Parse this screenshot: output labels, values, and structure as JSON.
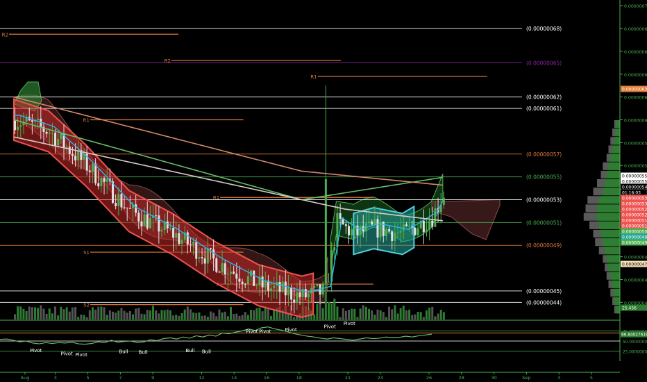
{
  "chart_data": {
    "type": "line",
    "theme": {
      "background": "#000000",
      "price_axis_color": "#4caf50",
      "up": "#4caf50",
      "down": "#ef5350",
      "pivot_color": "#e07b39",
      "fib_color": "#ffffff"
    },
    "price_axis": {
      "ylim": [
        4.25e-07,
        7.05e-08
      ],
      "ticks": [
        "0.00000070",
        "0.00000068",
        "0.00000066",
        "0.00000064",
        "0.00000062",
        "0.00000060",
        "0.00000058",
        "0.00000056",
        "0.00000054",
        "0.00000052",
        "0.00000050",
        "0.00000048",
        "0.00000046",
        "0.00000044"
      ]
    },
    "price_scale": {
      "min": 4.25e-07,
      "max": 7.05e-07
    },
    "time_axis": {
      "labels": [
        "Aug",
        "3",
        "5",
        "7",
        "9",
        "12",
        "14",
        "16",
        "18",
        "21",
        "23",
        "26",
        "28",
        "30",
        "Sep",
        "3",
        "5"
      ],
      "positions_days": [
        0,
        2,
        4,
        6,
        8,
        11,
        13,
        15,
        17,
        20,
        22,
        25,
        27,
        29,
        31,
        33,
        35
      ]
    },
    "level_lines": [
      {
        "label": "(0.00000068)",
        "price": 6.8e-07,
        "color": "#ffffff"
      },
      {
        "label": "(0.00000065)",
        "price": 6.5e-07,
        "color": "#8e24aa"
      },
      {
        "label": "(0.00000062)",
        "price": 6.2e-07,
        "color": "#ffffff"
      },
      {
        "label": "(0.00000061)",
        "price": 6.1e-07,
        "color": "#ffffff"
      },
      {
        "label": "(0.00000057)",
        "price": 5.7e-07,
        "color": "#e07b39"
      },
      {
        "label": "(0.00000055)",
        "price": 5.5e-07,
        "color": "#4caf50"
      },
      {
        "label": "(0.00000053)",
        "price": 5.3e-07,
        "color": "#ffffff"
      },
      {
        "label": "(0.00000051)",
        "price": 5.1e-07,
        "color": "#4caf50"
      },
      {
        "label": "(0.00000049)",
        "price": 4.9e-07,
        "color": "#e07b39"
      },
      {
        "label": "(0.00000045)",
        "price": 4.5e-07,
        "color": "#ffffff"
      },
      {
        "label": "(0.00000044)",
        "price": 4.4e-07,
        "color": "#ffffff"
      }
    ],
    "pivots": [
      {
        "label": "R2",
        "price": 6.75e-07,
        "x_start_day": 0,
        "x_end_day": 10
      },
      {
        "label": "R2",
        "price": 6.52e-07,
        "x_start_day": 10,
        "x_end_day": 20
      },
      {
        "label": "R1",
        "price": 6.38e-07,
        "x_start_day": 19,
        "x_end_day": 29
      },
      {
        "label": "R1",
        "price": 6e-07,
        "x_start_day": 5,
        "x_end_day": 14
      },
      {
        "label": "R1",
        "price": 5.32e-07,
        "x_start_day": 13,
        "x_end_day": 22
      },
      {
        "label": "S1",
        "price": 4.84e-07,
        "x_start_day": 5,
        "x_end_day": 14
      },
      {
        "label": "P",
        "price": 4.56e-07,
        "x_start_day": 13,
        "x_end_day": 22
      },
      {
        "label": "S2",
        "price": 4.38e-07,
        "x_start_day": 5,
        "x_end_day": 14
      }
    ],
    "price_badges": [
      {
        "label": "0.00000063",
        "bg": "#e07b39"
      },
      {
        "label": "0.00000055",
        "bg": "#ffffff"
      },
      {
        "label": "0.00000055",
        "bg": "#ffffff"
      },
      {
        "label": "0.00000054",
        "bg": "#000000"
      },
      {
        "label": "01:16:03",
        "bg": "#000000"
      },
      {
        "label": "0.00000053",
        "bg": "#ef5350"
      },
      {
        "label": "0.00000053",
        "bg": "#ef5350"
      },
      {
        "label": "0.00000052",
        "bg": "#ef5350"
      },
      {
        "label": "0.00000052",
        "bg": "#ef5350"
      },
      {
        "label": "0.00000051",
        "bg": "#ef5350"
      },
      {
        "label": "0.00000051",
        "bg": "#ef5350"
      },
      {
        "label": "0.00000050",
        "bg": "#4caf50"
      },
      {
        "label": "0.00000049",
        "bg": "#26a69a"
      },
      {
        "label": "0.00000049",
        "bg": "#4caf50"
      },
      {
        "label": "0.00000047",
        "bg": "#f5deb3"
      },
      {
        "label": "25.456",
        "bg": "#2e7d32"
      }
    ],
    "oscillator": {
      "ticks": [
        "75.00000000",
        "66.84027619",
        "50.00000000",
        "25.00000000"
      ],
      "value_label": "66.84027619",
      "ylim": [
        0,
        100
      ],
      "levels": [
        75,
        50,
        25
      ],
      "labels": [
        {
          "text": "Pivot",
          "day": 0.8,
          "value": 22
        },
        {
          "text": "Pivot",
          "day": 2.7,
          "value": 15
        },
        {
          "text": "Pivot",
          "day": 3.6,
          "value": 12
        },
        {
          "text": "Bull",
          "day": 6.2,
          "value": 20
        },
        {
          "text": "Bull",
          "day": 7.4,
          "value": 18
        },
        {
          "text": "Bull",
          "day": 10.3,
          "value": 22
        },
        {
          "text": "Bull",
          "day": 11.3,
          "value": 20
        },
        {
          "text": "Pivot",
          "day": 14.1,
          "value": 70
        },
        {
          "text": "Pivot",
          "day": 14.9,
          "value": 70
        },
        {
          "text": "Pivot",
          "day": 16.5,
          "value": 74
        },
        {
          "text": "Pivot",
          "day": 18.9,
          "value": 82
        },
        {
          "text": "Pivot",
          "day": 20.1,
          "value": 90
        }
      ],
      "series": [
        54,
        55,
        52,
        48,
        50,
        45,
        43,
        46,
        44,
        46,
        45,
        47,
        43,
        42,
        44,
        48,
        46,
        52,
        47,
        49,
        50,
        46,
        48,
        53,
        51,
        56,
        58,
        55,
        60,
        57,
        63,
        60,
        65,
        62,
        70,
        68,
        72,
        75,
        80,
        76,
        83,
        85,
        80,
        77,
        73,
        68,
        65,
        62,
        60,
        57,
        55,
        58,
        56,
        54,
        52,
        55,
        58,
        56,
        57,
        60,
        58,
        59,
        62,
        60,
        63,
        65,
        67
      ]
    },
    "volume_profile": {
      "bins_total": [
        0.15,
        0.2,
        0.25,
        0.3,
        0.35,
        0.45,
        0.5,
        0.6,
        0.7,
        0.85,
        0.9,
        0.95,
        0.8,
        0.7,
        0.65,
        0.55,
        0.45,
        0.4,
        0.35,
        0.3,
        0.25,
        0.2,
        0.15
      ],
      "bins_up": [
        0.1,
        0.12,
        0.15,
        0.2,
        0.25,
        0.3,
        0.35,
        0.4,
        0.45,
        0.55,
        0.6,
        0.62,
        0.55,
        0.5,
        0.45,
        0.4,
        0.35,
        0.3,
        0.25,
        0.2,
        0.18,
        0.14,
        0.1
      ]
    }
  }
}
